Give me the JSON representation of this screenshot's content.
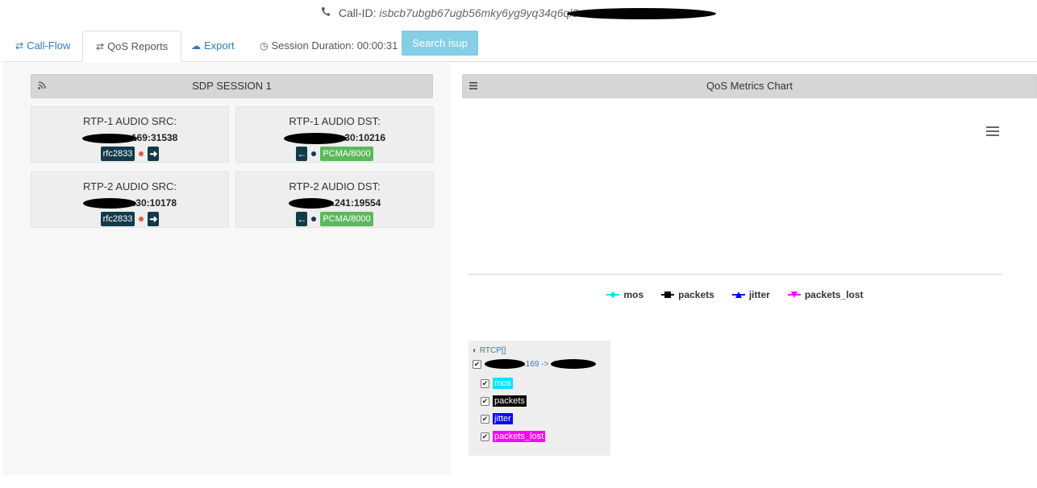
{
  "header": {
    "call_id_label": "Call-ID:",
    "call_id_value": "isbcb7ubgb67ugb56mky6yg9yq34q6ql3",
    "phone_icon": "phone-icon"
  },
  "tabs": [
    {
      "label": "Call-Flow",
      "icon": "exchange-icon"
    },
    {
      "label": "QoS Reports",
      "icon": "exchange-icon"
    },
    {
      "label": "Export",
      "icon": "cloud-icon"
    }
  ],
  "session_duration": "Session Duration: 00:00:31",
  "search_button": "Search isup",
  "sdp": {
    "title": "SDP SESSION 1",
    "cards": [
      {
        "title": "RTP-1 AUDIO SRC:",
        "addr": ".169:31538",
        "badge": "rfc2833"
      },
      {
        "title": "RTP-1 AUDIO DST:",
        "addr": ".30:10216",
        "badge": "PCMA/8000"
      },
      {
        "title": "RTP-2 AUDIO SRC:",
        "addr": ".30:10178",
        "badge": "rfc2833"
      },
      {
        "title": "RTP-2 AUDIO DST:",
        "addr": ".241:19554",
        "badge": "PCMA/8000"
      }
    ]
  },
  "chart": {
    "title": "QoS Metrics Chart",
    "legend": [
      {
        "label": "mos",
        "color": "#00e5ff"
      },
      {
        "label": "packets",
        "color": "#000000"
      },
      {
        "label": "jitter",
        "color": "#0000ff"
      },
      {
        "label": "packets_lost",
        "color": "#ff00ff"
      }
    ]
  },
  "chart_data": {
    "type": "line",
    "title": "",
    "series": [
      {
        "name": "mos",
        "values": []
      },
      {
        "name": "packets",
        "values": []
      },
      {
        "name": "jitter",
        "values": []
      },
      {
        "name": "packets_lost",
        "values": []
      }
    ]
  },
  "tree": {
    "root": "RTCP[]",
    "flow": ".169 -> .30",
    "items": [
      {
        "label": "mos",
        "color": "#00e5ff"
      },
      {
        "label": "packets",
        "color": "#000000"
      },
      {
        "label": "jitter",
        "color": "#0000ff"
      },
      {
        "label": "packets_lost",
        "color": "#ff00ff"
      }
    ]
  },
  "colors": {
    "dark_badge": "#123a4a",
    "green_badge": "#5cb85c",
    "red_dot": "#e9573f",
    "link": "#337ab7"
  }
}
